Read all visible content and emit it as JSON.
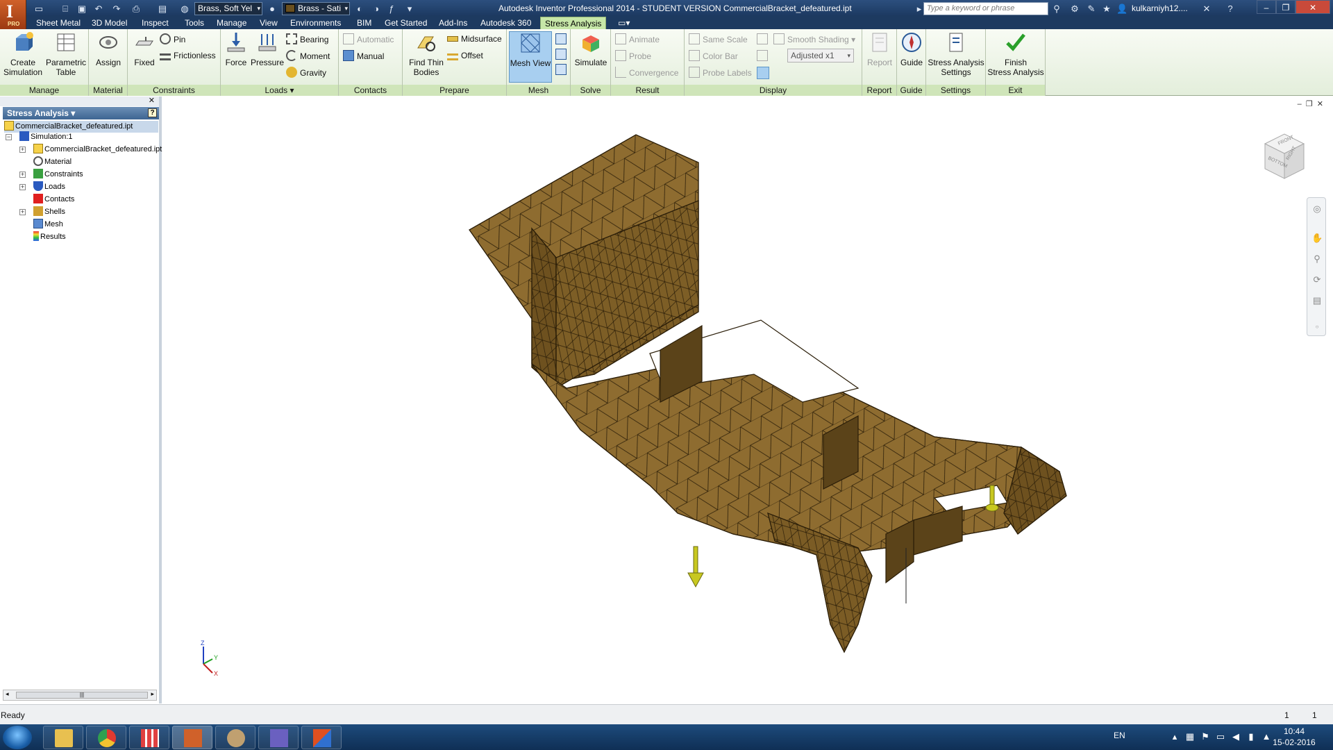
{
  "window": {
    "title": "Autodesk Inventor Professional 2014 - STUDENT VERSION    CommercialBracket_defeatured.ipt",
    "search_placeholder": "Type a keyword or phrase",
    "user": "kulkarniyh12....",
    "app_letter": "I",
    "app_badge": "PRO"
  },
  "quick_access": {
    "material_combo": "Brass, Soft Yel",
    "appearance_combo": "Brass - Sati"
  },
  "tabs": [
    {
      "label": "Sheet Metal"
    },
    {
      "label": "3D Model"
    },
    {
      "label": "Inspect"
    },
    {
      "label": "Tools"
    },
    {
      "label": "Manage"
    },
    {
      "label": "View"
    },
    {
      "label": "Environments"
    },
    {
      "label": "BIM"
    },
    {
      "label": "Get Started"
    },
    {
      "label": "Add-Ins"
    },
    {
      "label": "Autodesk 360"
    },
    {
      "label": "Stress Analysis"
    }
  ],
  "ribbon": {
    "manage": {
      "label": "Manage",
      "create_simulation": "Create\nSimulation",
      "parametric_table": "Parametric\nTable"
    },
    "material": {
      "label": "Material",
      "assign": "Assign"
    },
    "constraints": {
      "label": "Constraints",
      "fixed": "Fixed",
      "pin": "Pin",
      "frictionless": "Frictionless"
    },
    "loads": {
      "label": "Loads ▾",
      "force": "Force",
      "pressure": "Pressure",
      "bearing": "Bearing",
      "moment": "Moment",
      "gravity": "Gravity"
    },
    "contacts": {
      "label": "Contacts",
      "automatic": "Automatic",
      "manual": "Manual"
    },
    "prepare": {
      "label": "Prepare",
      "find_thin_bodies": "Find Thin\nBodies",
      "midsurface": "Midsurface",
      "offset": "Offset"
    },
    "mesh": {
      "label": "Mesh",
      "mesh_view": "Mesh View"
    },
    "solve": {
      "label": "Solve",
      "simulate": "Simulate"
    },
    "result": {
      "label": "Result",
      "animate": "Animate",
      "probe": "Probe",
      "convergence": "Convergence"
    },
    "display": {
      "label": "Display",
      "same_scale": "Same Scale",
      "color_bar": "Color Bar",
      "probe_labels": "Probe Labels",
      "smooth_shading": "Smooth Shading",
      "adjusted": "Adjusted x1"
    },
    "report": {
      "label": "Report",
      "report": "Report"
    },
    "guide": {
      "label": "Guide",
      "guide": "Guide"
    },
    "settings": {
      "label": "Settings",
      "stress_analysis_settings": "Stress Analysis\nSettings"
    },
    "exit": {
      "label": "Exit",
      "finish": "Finish\nStress Analysis"
    }
  },
  "browser": {
    "title": "Stress Analysis",
    "root": "CommercialBracket_defeatured.ipt",
    "items": [
      {
        "label": "Simulation:1"
      },
      {
        "label": "CommercialBracket_defeatured.ipt"
      },
      {
        "label": "Material"
      },
      {
        "label": "Constraints"
      },
      {
        "label": "Loads"
      },
      {
        "label": "Contacts"
      },
      {
        "label": "Shells"
      },
      {
        "label": "Mesh"
      },
      {
        "label": "Results"
      }
    ]
  },
  "viewcube": {
    "front": "FRONT",
    "bottom": "BOTTOM",
    "right": "RIGHT"
  },
  "triad": {
    "x": "X",
    "y": "Y",
    "z": "Z"
  },
  "status": {
    "text": "Ready",
    "num1": "1",
    "num2": "1"
  },
  "taskbar": {
    "lang": "EN",
    "time": "10:44",
    "date": "15-02-2016"
  },
  "colors": {
    "mesh_fill": "#8a6a2e",
    "load_arrow": "#c8c820",
    "active_tab": "#c7e7a8"
  }
}
